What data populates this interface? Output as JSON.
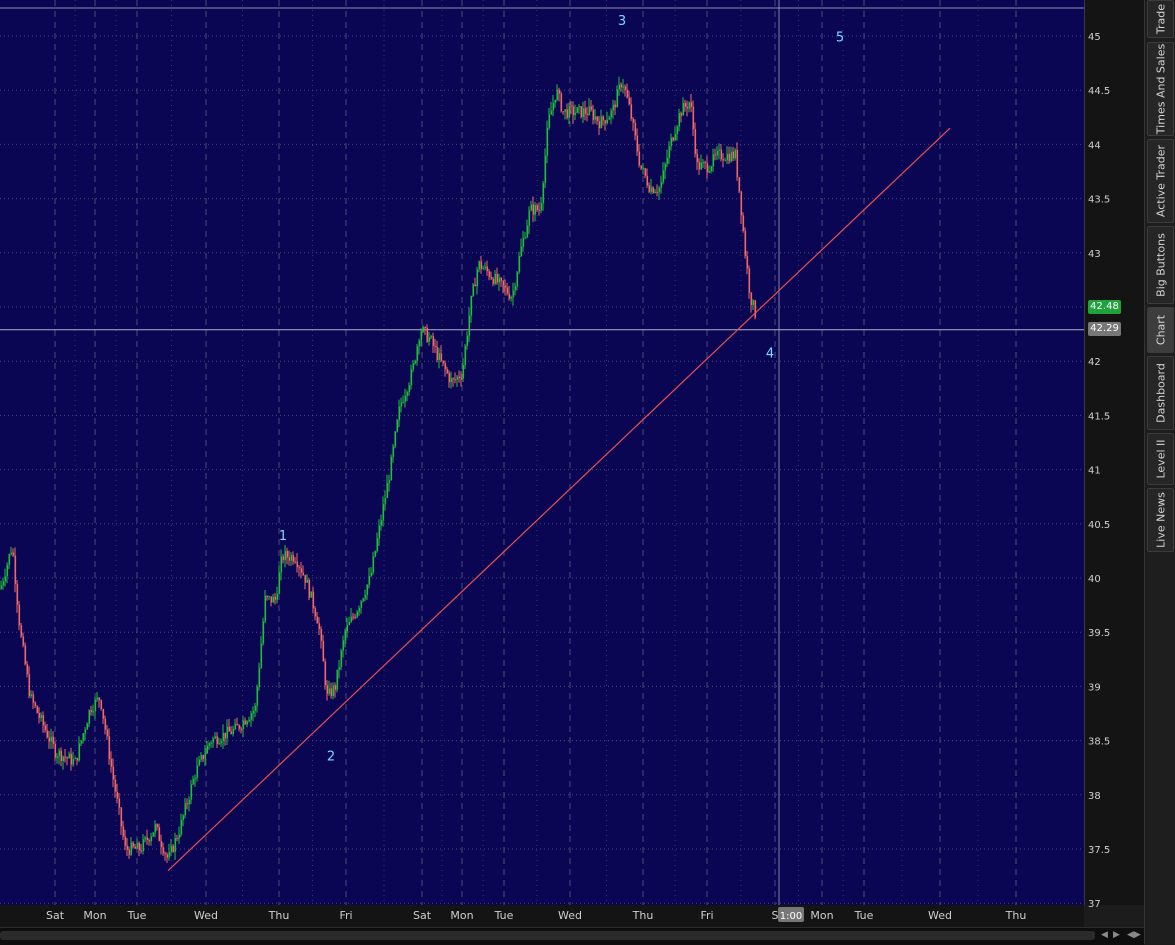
{
  "chart_data": {
    "type": "candlestick",
    "title": "",
    "y_ticks": [
      "45",
      "44.5",
      "44",
      "43.5",
      "43",
      "42.5",
      "42",
      "41.5",
      "41",
      "40.5",
      "40",
      "39.5",
      "39",
      "38.5",
      "38",
      "37.5",
      "37"
    ],
    "ylim": [
      37,
      45.3
    ],
    "x_ticks": [
      "Sat",
      "Mon",
      "Tue",
      "Wed",
      "Thu",
      "Fri",
      "Sat",
      "Mon",
      "Tue",
      "Wed",
      "Thu",
      "Fri",
      "S",
      "Mon",
      "Tue",
      "Wed",
      "Thu"
    ],
    "waypoints": [
      [
        0,
        39.9
      ],
      [
        12,
        40.3
      ],
      [
        20,
        39.5
      ],
      [
        30,
        38.9
      ],
      [
        45,
        38.6
      ],
      [
        55,
        38.4
      ],
      [
        75,
        38.3
      ],
      [
        90,
        38.8
      ],
      [
        100,
        38.9
      ],
      [
        112,
        38.2
      ],
      [
        125,
        37.5
      ],
      [
        140,
        37.5
      ],
      [
        155,
        37.7
      ],
      [
        168,
        37.4
      ],
      [
        180,
        37.7
      ],
      [
        195,
        38.2
      ],
      [
        210,
        38.5
      ],
      [
        235,
        38.6
      ],
      [
        255,
        38.8
      ],
      [
        265,
        39.8
      ],
      [
        275,
        39.8
      ],
      [
        282,
        40.2
      ],
      [
        295,
        40.2
      ],
      [
        305,
        40.0
      ],
      [
        318,
        39.6
      ],
      [
        327,
        38.9
      ],
      [
        335,
        39.0
      ],
      [
        345,
        39.5
      ],
      [
        356,
        39.7
      ],
      [
        370,
        40.0
      ],
      [
        380,
        40.5
      ],
      [
        390,
        41.0
      ],
      [
        400,
        41.6
      ],
      [
        412,
        41.9
      ],
      [
        420,
        42.3
      ],
      [
        430,
        42.2
      ],
      [
        440,
        42.0
      ],
      [
        452,
        41.8
      ],
      [
        462,
        41.9
      ],
      [
        470,
        42.5
      ],
      [
        478,
        42.9
      ],
      [
        490,
        42.8
      ],
      [
        500,
        42.7
      ],
      [
        512,
        42.6
      ],
      [
        520,
        43.0
      ],
      [
        530,
        43.4
      ],
      [
        540,
        43.4
      ],
      [
        548,
        44.2
      ],
      [
        556,
        44.5
      ],
      [
        563,
        44.3
      ],
      [
        575,
        44.3
      ],
      [
        590,
        44.3
      ],
      [
        600,
        44.2
      ],
      [
        612,
        44.3
      ],
      [
        622,
        44.6
      ],
      [
        630,
        44.3
      ],
      [
        640,
        43.8
      ],
      [
        650,
        43.6
      ],
      [
        660,
        43.6
      ],
      [
        670,
        44.0
      ],
      [
        680,
        44.3
      ],
      [
        690,
        44.4
      ],
      [
        697,
        43.8
      ],
      [
        708,
        43.8
      ],
      [
        718,
        43.9
      ],
      [
        735,
        43.9
      ],
      [
        740,
        43.5
      ],
      [
        745,
        43.0
      ],
      [
        750,
        42.6
      ],
      [
        755,
        42.44
      ]
    ],
    "trendline": {
      "from": {
        "day": "Tue",
        "price": 37.3
      },
      "to": {
        "day": "Wed",
        "price": 44.15
      }
    },
    "wave_labels": [
      "1",
      "2",
      "3",
      "4",
      "5"
    ],
    "wave_points": [
      {
        "label": "1",
        "price": 40.35
      },
      {
        "label": "2",
        "price": 38.5
      },
      {
        "label": "3",
        "price": 45.1
      },
      {
        "label": "4",
        "price": 42.2
      },
      {
        "label": "5",
        "price": 44.95
      }
    ],
    "last_price": "42.48",
    "crosshair_price": "42.29",
    "crosshair_time": "1:00",
    "colors": {
      "background": "#0b0653",
      "up": "#22c03a",
      "down": "#f06a6a",
      "trendline": "#e85050",
      "wave_label": "#7fd8ff",
      "grid": "#5a5a80",
      "last_price_bg": "#1fa33a",
      "crosshair_label_bg": "#777777"
    }
  },
  "side_tabs": [
    "Trade",
    "Times And Sales",
    "Active Trader",
    "Big Buttons",
    "Chart",
    "Dashboard",
    "Level II",
    "Live News"
  ],
  "active_tab": "Chart",
  "icons": {
    "scroll_left": "scroll-left-icon",
    "scroll_right": "scroll-right-icon",
    "expand": "expand-icon"
  }
}
